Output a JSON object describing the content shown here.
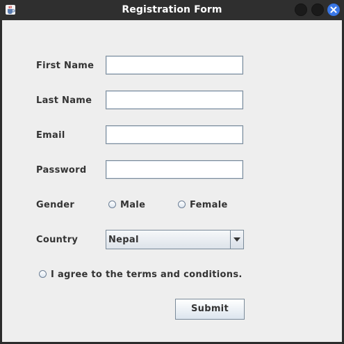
{
  "window": {
    "title": "Registration Form",
    "app_icon": "java-cup-icon",
    "controls": [
      "minimize-icon",
      "maximize-icon",
      "close-icon"
    ],
    "accent_color": "#3a78e8"
  },
  "form": {
    "first_name": {
      "label": "First Name",
      "value": ""
    },
    "last_name": {
      "label": "Last Name",
      "value": ""
    },
    "email": {
      "label": "Email",
      "value": ""
    },
    "password": {
      "label": "Password",
      "value": ""
    },
    "gender": {
      "label": "Gender",
      "options": [
        "Male",
        "Female"
      ],
      "selected": null
    },
    "country": {
      "label": "Country",
      "selected": "Nepal"
    },
    "terms": {
      "label": "I agree to the terms and conditions.",
      "checked": false
    },
    "submit_label": "Submit"
  }
}
